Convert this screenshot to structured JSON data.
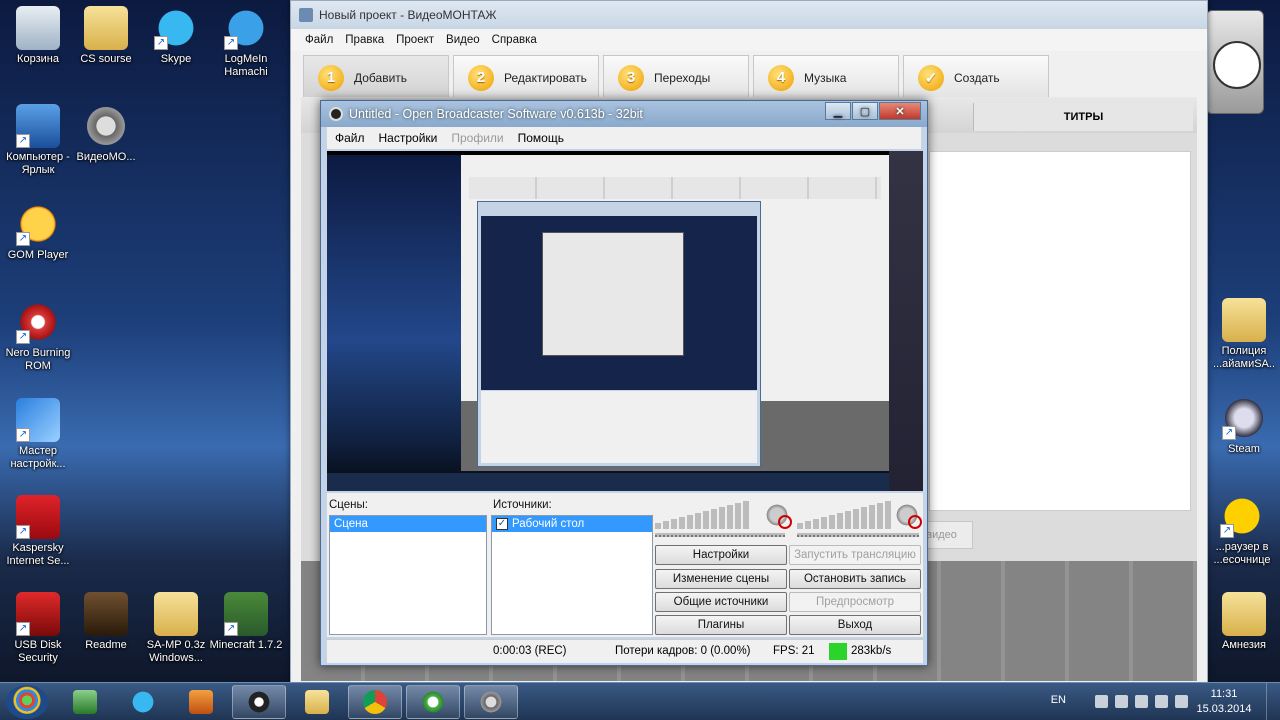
{
  "desktop": {
    "left_icons": [
      {
        "label": "Корзина",
        "icon": "recycle-bin-icon"
      },
      {
        "label": "CS sourse",
        "icon": "folder-icon"
      },
      {
        "label": "Skype",
        "icon": "skype-icon"
      },
      {
        "label": "LogMeIn Hamachi",
        "icon": "hamachi-icon"
      },
      {
        "label": "Компьютер - Ярлык",
        "icon": "computer-icon"
      },
      {
        "label": "ВидеоМО...",
        "icon": "video-reel-icon"
      },
      {
        "label": "GOM Player",
        "icon": "gom-player-icon"
      },
      {
        "label": "Nero Burning ROM",
        "icon": "nero-icon"
      },
      {
        "label": "Мастер настройк...",
        "icon": "setup-wizard-icon"
      },
      {
        "label": "Kaspersky Internet Se...",
        "icon": "kaspersky-icon"
      },
      {
        "label": "USB Disk Security",
        "icon": "usb-security-icon"
      },
      {
        "label": "Readme",
        "icon": "readme-icon"
      },
      {
        "label": "SA-MP 0.3z Windows...",
        "icon": "folder-icon"
      },
      {
        "label": "Minecraft 1.7.2",
        "icon": "minecraft-icon"
      }
    ],
    "right_icons": [
      {
        "label": "Полиция ...айамиSA..",
        "icon": "folder-icon"
      },
      {
        "label": "Steam",
        "icon": "steam-icon"
      },
      {
        "label": "...раузер в ...есочнице",
        "icon": "yandex-browser-icon"
      },
      {
        "label": "Амнезия",
        "icon": "folder-icon"
      }
    ]
  },
  "video_editor": {
    "title": "Новый проект - ВидеоМОНТАЖ",
    "menu": [
      "Файл",
      "Правка",
      "Проект",
      "Видео",
      "Справка"
    ],
    "steps": [
      {
        "num": "1",
        "label": "Добавить"
      },
      {
        "num": "2",
        "label": "Редактировать"
      },
      {
        "num": "3",
        "label": "Переходы"
      },
      {
        "num": "4",
        "label": "Музыка"
      },
      {
        "num": "✓",
        "label": "Создать"
      }
    ],
    "tab_titles": "ТИТРЫ",
    "video_button_partial": "...видео"
  },
  "obs": {
    "title": "Untitled - Open Broadcaster Software v0.613b - 32bit",
    "menu": {
      "file": "Файл",
      "settings": "Настройки",
      "profiles": "Профили",
      "help": "Помощь"
    },
    "scenes_label": "Сцены:",
    "scenes": [
      "Сцена"
    ],
    "sources_label": "Источники:",
    "sources": [
      {
        "name": "Рабочий стол",
        "checked": true
      }
    ],
    "buttons": {
      "settings": "Настройки",
      "start_stream": "Запустить трансляцию",
      "edit_scene": "Изменение сцены",
      "stop_recording": "Остановить запись",
      "global_sources": "Общие источники",
      "preview": "Предпросмотр",
      "plugins": "Плагины",
      "exit": "Выход"
    },
    "status": {
      "time": "0:00:03 (REC)",
      "dropped_frames": "Потери кадров: 0 (0.00%)",
      "fps": "FPS: 21",
      "bitrate": "283kb/s",
      "bitrate_color": "#2ad42a"
    }
  },
  "taskbar": {
    "apps": [
      "explorer-icon",
      "skype-icon",
      "media-player-icon",
      "obs-icon",
      "folder-icon",
      "chrome-icon",
      "utorrent-icon",
      "video-reel-icon"
    ],
    "active_app": "obs-icon",
    "language": "EN",
    "time": "11:31",
    "date": "15.03.2014"
  }
}
